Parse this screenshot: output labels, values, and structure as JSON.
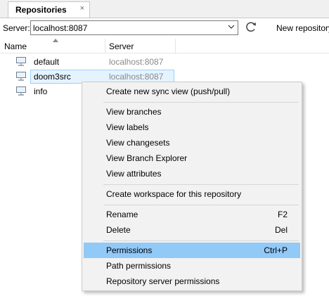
{
  "tab": {
    "title": "Repositories",
    "close_glyph": "×"
  },
  "toolbar": {
    "server_label": "Server:",
    "server_value": "localhost:8087",
    "dropdown_icon": "chevron-down-icon",
    "refresh_icon": "refresh-icon",
    "new_repository_label": "New repository"
  },
  "columns": {
    "name": "Name",
    "server": "Server"
  },
  "repositories": [
    {
      "name": "default",
      "server": "localhost:8087",
      "selected": false
    },
    {
      "name": "doom3src",
      "server": "localhost:8087",
      "selected": true
    },
    {
      "name": "info",
      "server": "",
      "selected": false
    }
  ],
  "context_menu": {
    "items": [
      {
        "label": "Create new sync view (push/pull)",
        "shortcut": ""
      },
      {
        "label": "View branches",
        "shortcut": ""
      },
      {
        "label": "View labels",
        "shortcut": ""
      },
      {
        "label": "View changesets",
        "shortcut": ""
      },
      {
        "label": "View Branch Explorer",
        "shortcut": ""
      },
      {
        "label": "View attributes",
        "shortcut": ""
      },
      {
        "label": "Create workspace for this repository",
        "shortcut": ""
      },
      {
        "label": "Rename",
        "shortcut": "F2"
      },
      {
        "label": "Delete",
        "shortcut": "Del"
      },
      {
        "label": "Permissions",
        "shortcut": "Ctrl+P",
        "highlighted": true
      },
      {
        "label": "Path permissions",
        "shortcut": ""
      },
      {
        "label": "Repository server permissions",
        "shortcut": ""
      }
    ]
  },
  "colors": {
    "menu_highlight": "#91c9f7",
    "row_selection": "#e5f3ff",
    "row_selection_border": "#99d1ff",
    "muted_text": "#8a8a8a"
  }
}
